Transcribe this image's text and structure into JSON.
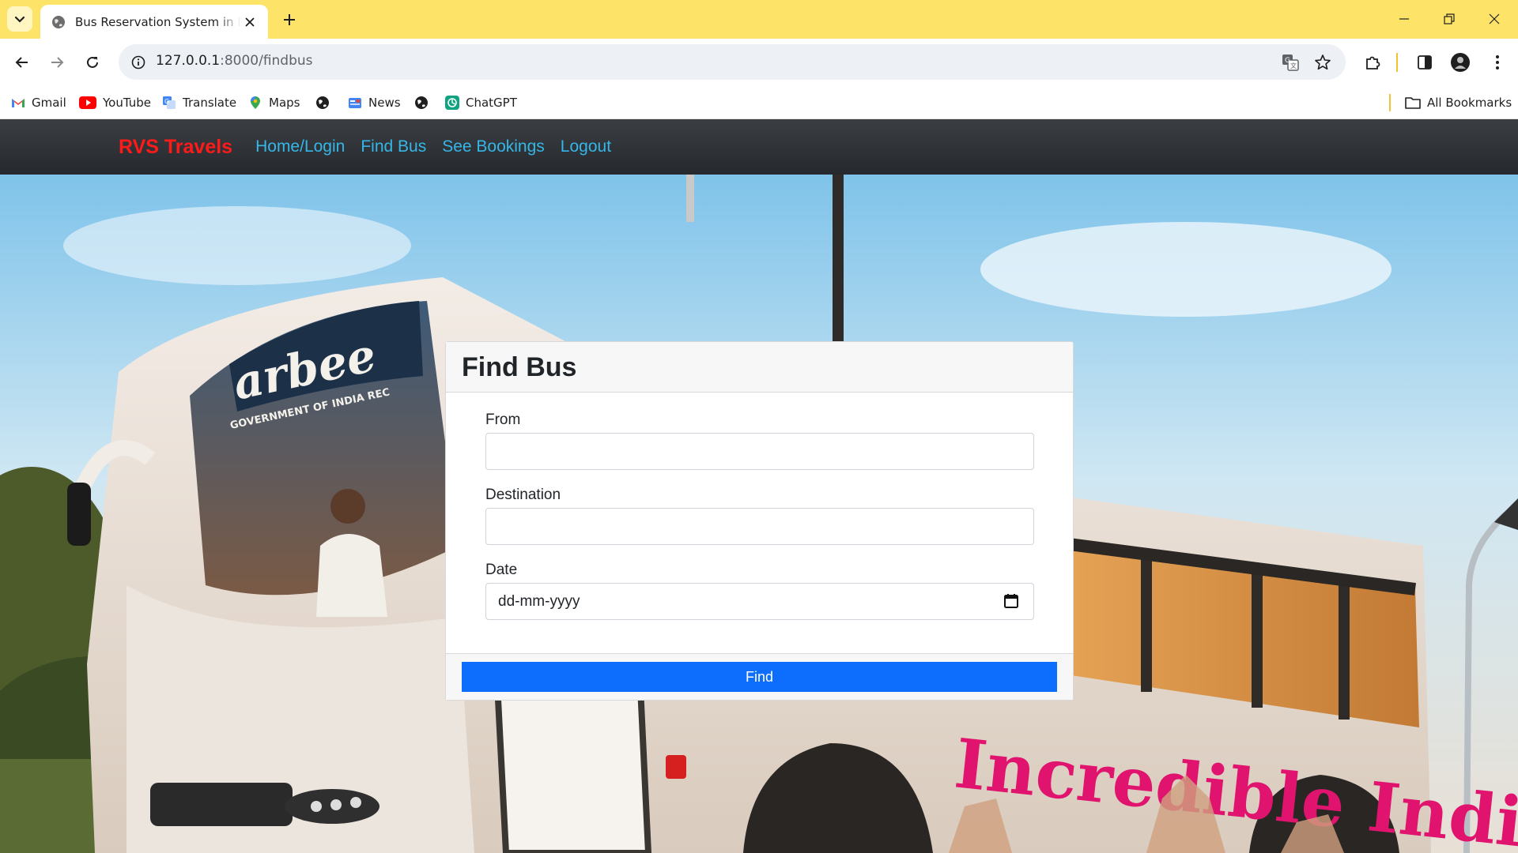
{
  "browser": {
    "tab_title": "Bus Reservation System in Djan",
    "url_host": "127.0.0.1",
    "url_path": ":8000/findbus",
    "bookmarks": [
      {
        "label": "Gmail",
        "icon": "gmail-icon"
      },
      {
        "label": "YouTube",
        "icon": "youtube-icon"
      },
      {
        "label": "Translate",
        "icon": "translate-icon"
      },
      {
        "label": "Maps",
        "icon": "maps-icon"
      },
      {
        "label": "",
        "icon": "globe-icon"
      },
      {
        "label": "News",
        "icon": "news-icon"
      },
      {
        "label": "",
        "icon": "globe-icon"
      },
      {
        "label": "ChatGPT",
        "icon": "chatgpt-icon"
      }
    ],
    "all_bookmarks_label": "All Bookmarks",
    "colors": {
      "tabbar": "#fde468",
      "omnibox": "#edf0f5"
    }
  },
  "site": {
    "brand": "RVS Travels",
    "nav": [
      "Home/Login",
      "Find Bus",
      "See Bookings",
      "Logout"
    ],
    "colors": {
      "brand": "#ff1a1a",
      "nav_link": "#34b7e8",
      "navbar": "#2b2f33",
      "primary_button": "#0d6efd"
    }
  },
  "hero": {
    "bus_text": "Incredible India",
    "windshield_text": "arbee",
    "windshield_subtext": "GOVERNMENT OF INDIA REC"
  },
  "form": {
    "title": "Find Bus",
    "from_label": "From",
    "from_value": "",
    "destination_label": "Destination",
    "destination_value": "",
    "date_label": "Date",
    "date_placeholder": "dd-mm-yyyy",
    "submit_label": "Find"
  }
}
